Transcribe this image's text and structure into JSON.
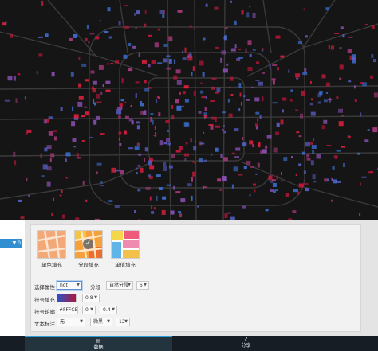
{
  "sidebar": {
    "tab_label": "▼ 0"
  },
  "styles": [
    {
      "label": "单色填充",
      "icon": "single-fill-icon",
      "selected": false
    },
    {
      "label": "分段填充",
      "icon": "graded-fill-icon",
      "selected": true
    },
    {
      "label": "单值填充",
      "icon": "unique-fill-icon",
      "selected": false
    }
  ],
  "form": {
    "attr_label": "选择属性",
    "attr_value": "hot",
    "seg_label": "分段",
    "seg_method": "自然分段",
    "seg_count": "5",
    "fill_label": "符号填充",
    "fill_gradient": [
      "#2a52c7",
      "#b0163a"
    ],
    "fill_opacity": "0.8",
    "outline_label": "符号轮廓",
    "outline_color": "#FFFCEB",
    "outline_width": "0",
    "outline_opacity": "0.4",
    "text_label": "文本标注",
    "text_field": "无",
    "text_font": "微黑",
    "text_size": "12"
  },
  "bottom_tabs": [
    {
      "label": "数据",
      "icon": "data-icon",
      "active": true
    },
    {
      "label": "分享",
      "icon": "share-icon",
      "active": false
    }
  ],
  "colors": {
    "accent": "#2b9fd9",
    "class_low": "#3b6fd1",
    "class_high": "#c8163a"
  }
}
